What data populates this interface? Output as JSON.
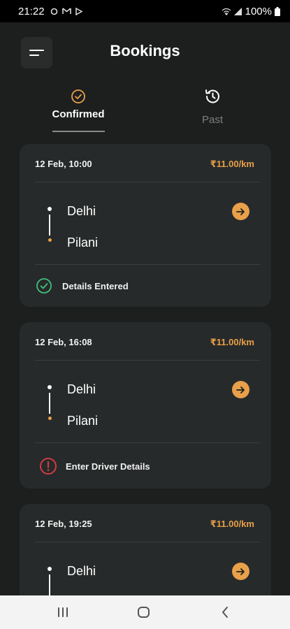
{
  "status_bar": {
    "time": "21:22",
    "battery": "100%"
  },
  "header": {
    "title": "Bookings"
  },
  "tabs": [
    {
      "label": "Confirmed",
      "icon": "check-circle-icon",
      "active": true
    },
    {
      "label": "Past",
      "icon": "history-icon",
      "active": false
    }
  ],
  "bookings": [
    {
      "date": "12 Feb, 10:00",
      "price": "₹11.00/km",
      "from": "Delhi",
      "to": "Pilani",
      "status": "Details Entered",
      "status_icon": "check-circle-icon",
      "status_color": "#3fbf7f"
    },
    {
      "date": "12 Feb, 16:08",
      "price": "₹11.00/km",
      "from": "Delhi",
      "to": "Pilani",
      "status": "Enter Driver Details",
      "status_icon": "alert-circle-icon",
      "status_color": "#d23a44"
    },
    {
      "date": "12 Feb, 19:25",
      "price": "₹11.00/km",
      "from": "Delhi"
    }
  ],
  "colors": {
    "accent": "#e8a04a",
    "background": "#1d1f1f",
    "card": "#272a2a"
  }
}
